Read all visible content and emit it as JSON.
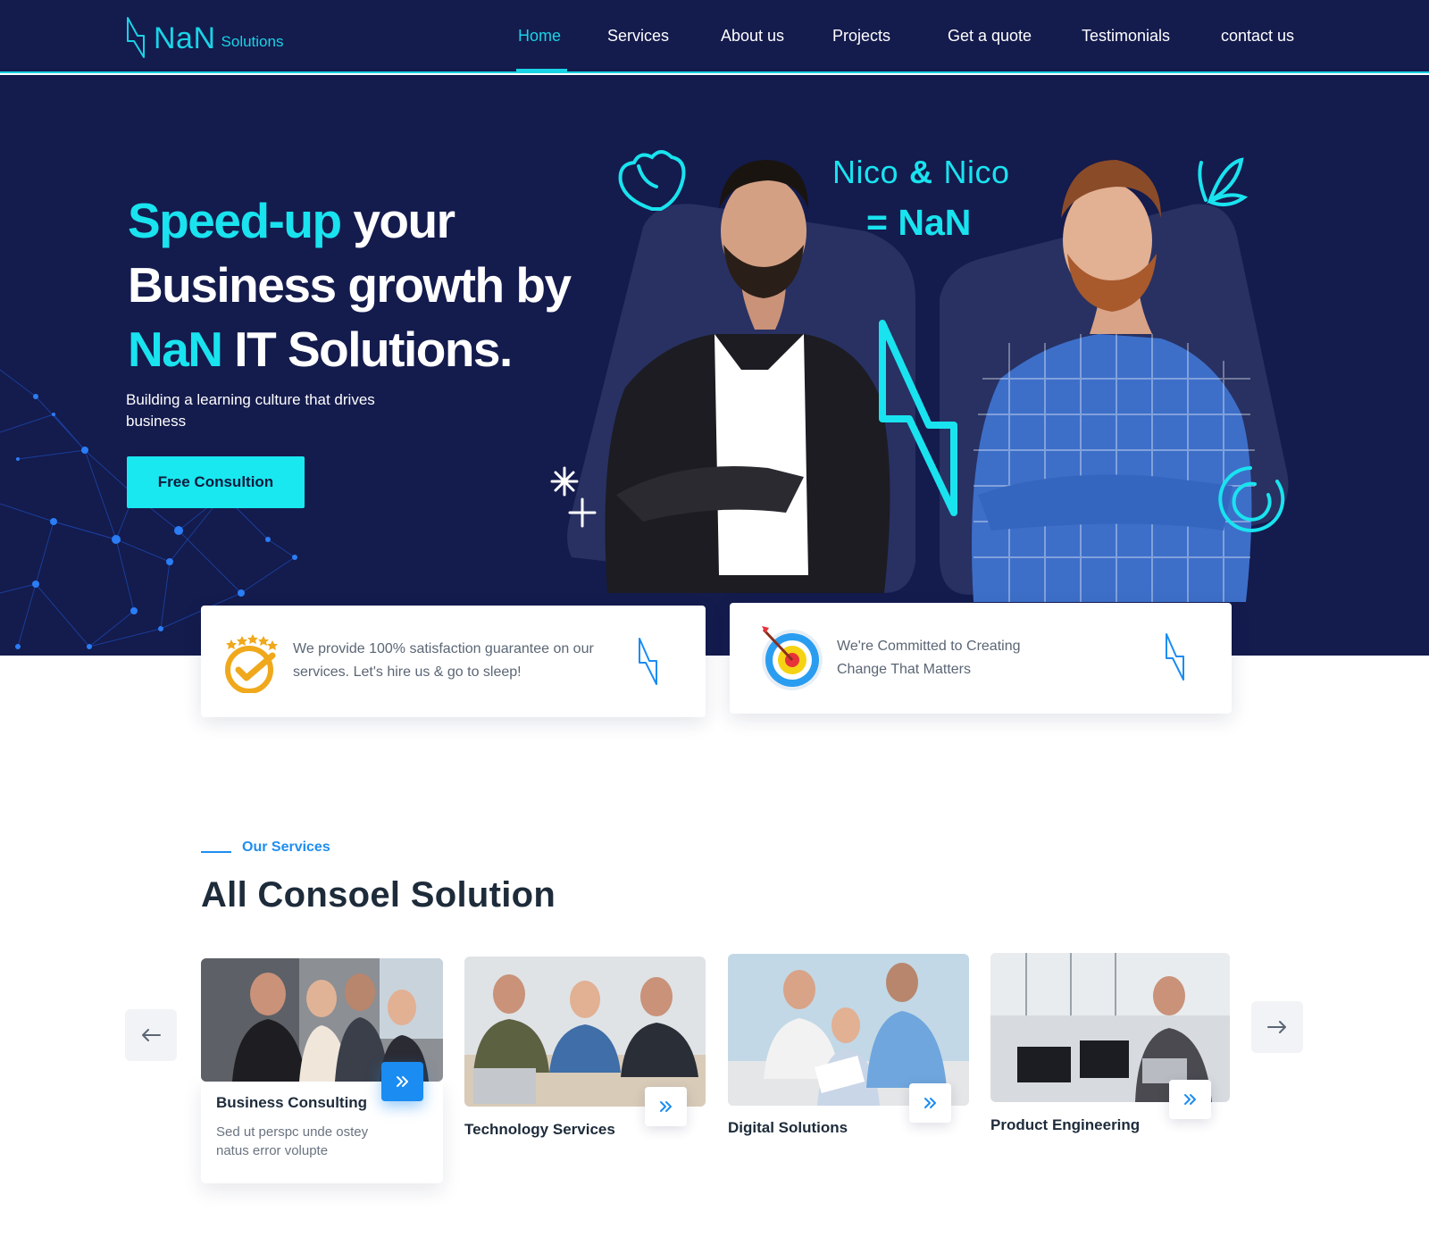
{
  "brand": {
    "name": "NaN",
    "sub": "Solutions",
    "accent": "#19e3ef",
    "navy": "#141b4d",
    "blue": "#1a8cf2"
  },
  "nav": {
    "items": [
      {
        "label": "Home",
        "active": true
      },
      {
        "label": "Services"
      },
      {
        "label": "About us"
      },
      {
        "label": "Projects"
      },
      {
        "label": "Get a quote"
      },
      {
        "label": "Testimonials"
      },
      {
        "label": "contact us"
      }
    ]
  },
  "hero": {
    "title_accent_1": "Speed-up",
    "title_part_1": " your",
    "title_part_2": "Business growth by",
    "title_accent_2": "NaN",
    "title_part_3": " IT Solutions.",
    "subtitle": "Building a learning culture that drives business",
    "cta_label": "Free Consultion",
    "nico_left": "Nico",
    "nico_amp": "&",
    "nico_right": "Nico",
    "nan_equation": "= NaN"
  },
  "features": [
    {
      "icon": "rating-check-icon",
      "text": "We provide 100% satisfaction guarantee on our services. Let's hire us & go to sleep!"
    },
    {
      "icon": "target-icon",
      "text": "We're Committed to Creating Change That Matters"
    }
  ],
  "services": {
    "eyebrow": "Our Services",
    "title": "All Consoel Solution",
    "cards": [
      {
        "name": "Business Consulting",
        "desc": "Sed ut perspc unde ostey natus error volupte"
      },
      {
        "name": "Technology Services"
      },
      {
        "name": "Digital Solutions"
      },
      {
        "name": "Product Engineering"
      }
    ],
    "prev_icon": "arrow-left-icon",
    "next_icon": "arrow-right-icon"
  }
}
